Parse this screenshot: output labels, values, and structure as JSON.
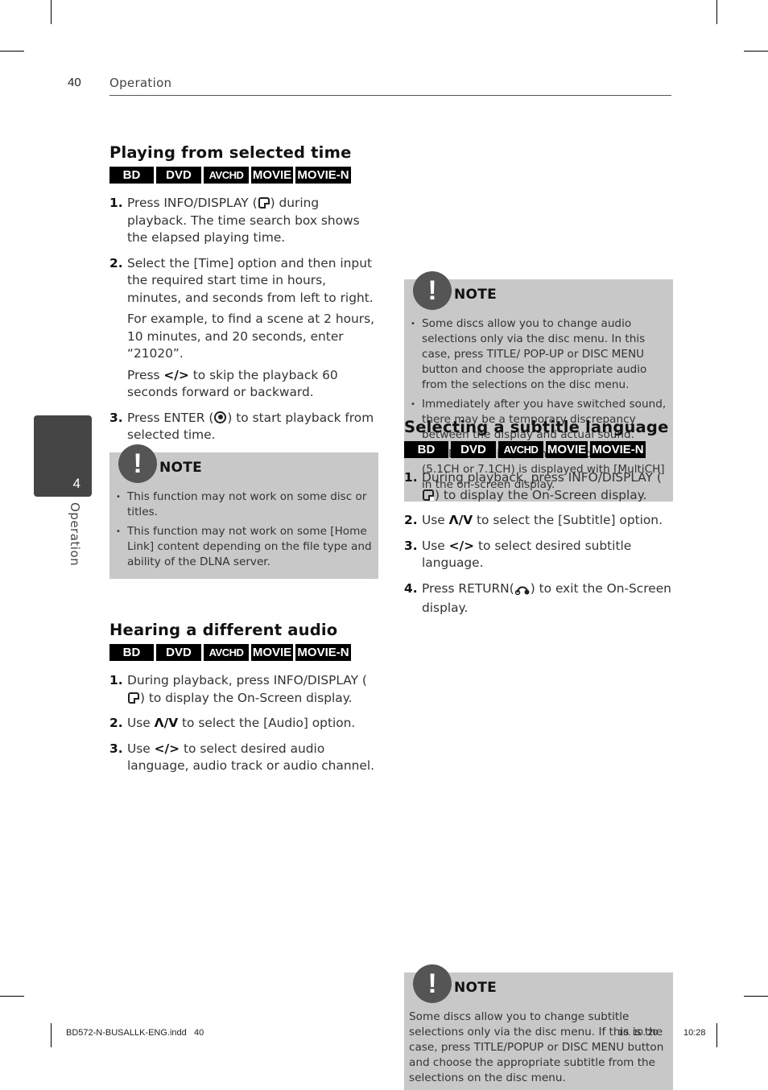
{
  "header": {
    "page_number": "40",
    "running_head": "Operation"
  },
  "side_tab": {
    "chapter_number": "4",
    "chapter_label": "Operation"
  },
  "badges": [
    "BD",
    "DVD",
    "AVCHD",
    "MOVIE",
    "MOVIE-N"
  ],
  "sections": {
    "playing_time": {
      "title": "Playing from selected time",
      "steps": [
        {
          "num": "1.",
          "pre": "Press INFO/DISPLAY (",
          "post": ") during playback. The time search box shows the elapsed playing time."
        },
        {
          "num": "2.",
          "text": " Select the [Time] option and then input the required start time in hours, minutes, and seconds from left to right.",
          "example": "For example, to find a scene at 2 hours, 10 minutes, and 20 seconds, enter “21020”.",
          "skip_pre": "Press ",
          "skip_glyph": "</>",
          "skip_post": " to skip the playback 60 seconds forward or backward."
        },
        {
          "num": "3.",
          "pre": "Press ENTER (",
          "post": ") to start playback from selected time."
        }
      ],
      "note": {
        "title": "NOTE",
        "icon": "exclamation-icon",
        "items": [
          "This function may not work on some disc or titles.",
          "This function may not work on some [Home Link] content depending on the file type and ability of the DLNA server."
        ]
      }
    },
    "audio": {
      "title": "Hearing a different audio",
      "steps": [
        {
          "num": "1.",
          "pre": "During playback, press INFO/DISPLAY (",
          "post": ") to display the On-Screen display."
        },
        {
          "num": "2.",
          "pre": "Use ",
          "glyph": "Λ/V",
          "post": " to select the [Audio] option."
        },
        {
          "num": "3.",
          "pre": "Use ",
          "glyph": "</>",
          "post": " to select desired audio language, audio track or audio channel."
        }
      ],
      "note": {
        "title": "NOTE",
        "items": [
          "Some discs allow you to change audio selections only via the disc menu. In this case, press TITLE/ POP-UP or DISC MENU button and choose the appropriate audio from the selections on the disc menu.",
          "Immediately after you have switched sound, there may be a temporary discrepancy between the display and actual sound.",
          "On BD-ROM disc, the multi audio format (5.1CH or 7.1CH) is displayed with [MultiCH] in the on-screen display."
        ]
      }
    },
    "subtitle": {
      "title": "Selecting a subtitle language",
      "steps": [
        {
          "num": "1.",
          "pre": "During playback, press INFO/DISPLAY (",
          "post": ") to display the On-Screen display."
        },
        {
          "num": "2.",
          "pre": "Use ",
          "glyph": "Λ/V",
          "post": " to select the [Subtitle] option."
        },
        {
          "num": "3.",
          "pre": "Use ",
          "glyph": "</>",
          "post": " to select desired subtitle language."
        },
        {
          "num": "4.",
          "pre": "Press RETURN(",
          "post": ") to exit the On-Screen display."
        }
      ],
      "note": {
        "title": "NOTE",
        "text": "Some discs allow you to change subtitle selections only via the disc menu. If this is the case, press TITLE/POPUP or DISC MENU button and choose the appropriate subtitle from the selections on the disc menu."
      }
    }
  },
  "footer": {
    "file": "BD572-N-BUSALLK-ENG.indd   40",
    "date": "10. 10. 20",
    "time": "10:28"
  }
}
